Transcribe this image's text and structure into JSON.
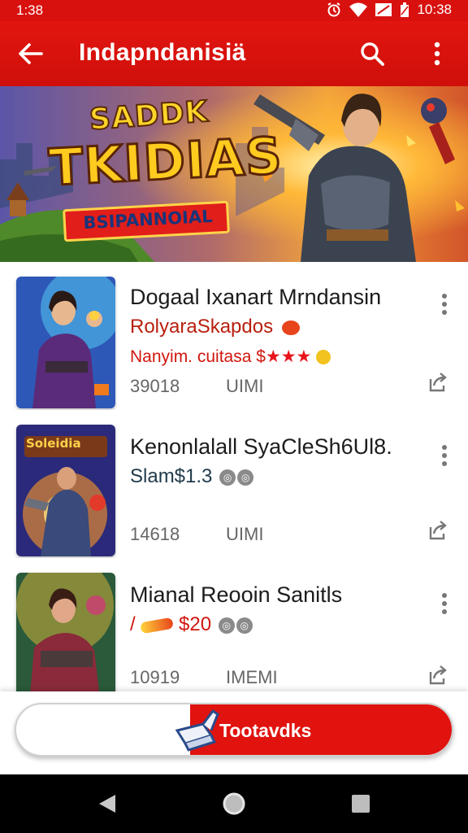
{
  "status_bar": {
    "time_left": "1:38",
    "time_right": "10:38"
  },
  "app_bar": {
    "title": "Indapndanisiä"
  },
  "banner": {
    "title_line1": "SADDK",
    "title_line2": "TKIDIAS",
    "ribbon_label": "BSIPANNOIAL"
  },
  "items": [
    {
      "title": "Dogaal Ixanart Mrndansin",
      "subtitle": "RolyaraSkapdos",
      "price_text": "Nanyim. cuitasa $",
      "stars": "★★★",
      "count": "39018",
      "tag": "UIMI"
    },
    {
      "title": "Kenonlalall SyaCleSh6Ul8.",
      "subtitle": "Slam$1.3",
      "count": "14618",
      "tag": "UIMI"
    },
    {
      "title": "Mianal Reooin Sanitls",
      "price_text": "/ ",
      "price": "$20",
      "count": "10919",
      "tag": "IMEMI"
    }
  ],
  "action": {
    "label": "Tootavdks"
  },
  "colors": {
    "primary_red": "#d8110f",
    "star_red": "#e8141c",
    "badge_gold": "#ffcb1f"
  }
}
